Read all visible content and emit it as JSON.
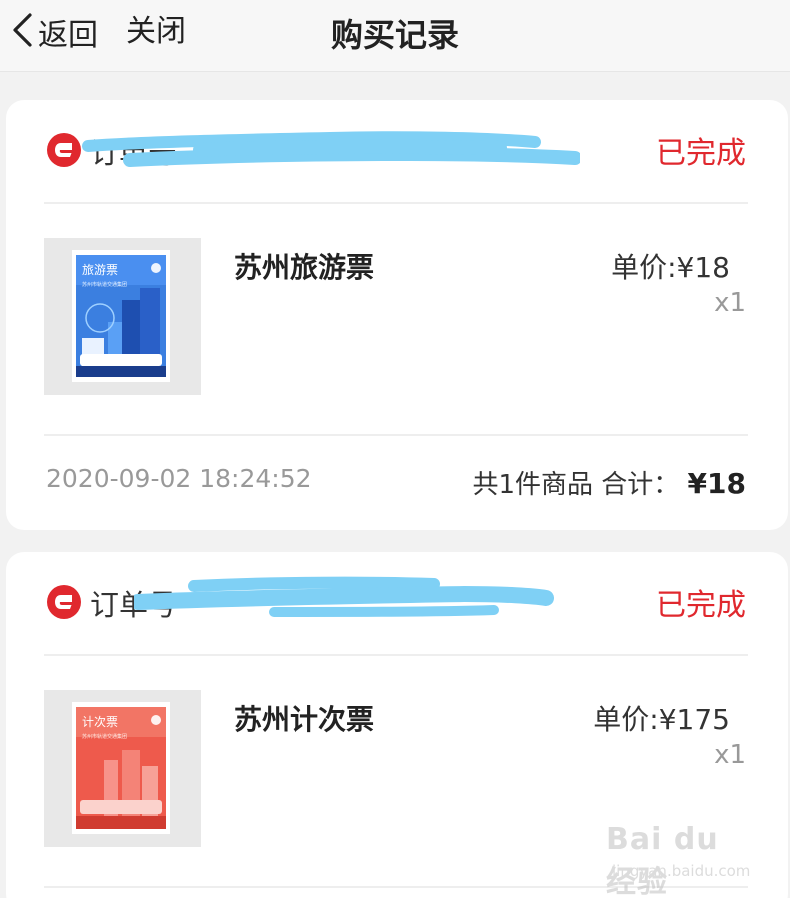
{
  "nav": {
    "back_label": "返回",
    "close_label": "关闭",
    "title": "购买记录"
  },
  "orders": [
    {
      "order_label": "订单号",
      "status": "已完成",
      "product": {
        "name": "苏州旅游票",
        "unit_price": "单价:¥18",
        "quantity": "x1",
        "thumb_title": "旅游票",
        "thumb_sub": "苏州市轨道交通集团"
      },
      "timestamp": "2020-09-02 18:24:52",
      "summary_count": "共1件商品",
      "summary_total_label": "合计：",
      "summary_total_value": "¥18"
    },
    {
      "order_label": "订单号",
      "status": "已完成",
      "product": {
        "name": "苏州计次票",
        "unit_price": "单价:¥175",
        "quantity": "x1",
        "thumb_title": "计次票",
        "thumb_sub": "苏州市轨道交通集团"
      }
    }
  ],
  "watermark": {
    "main": "Bai du 经验",
    "sub": "jingyan.baidu.com"
  },
  "colors": {
    "status_red": "#e0282e",
    "redaction_blue": "#7fd0f5",
    "ticket_blue": "#3b7fe0",
    "ticket_red": "#ee5a4c"
  }
}
